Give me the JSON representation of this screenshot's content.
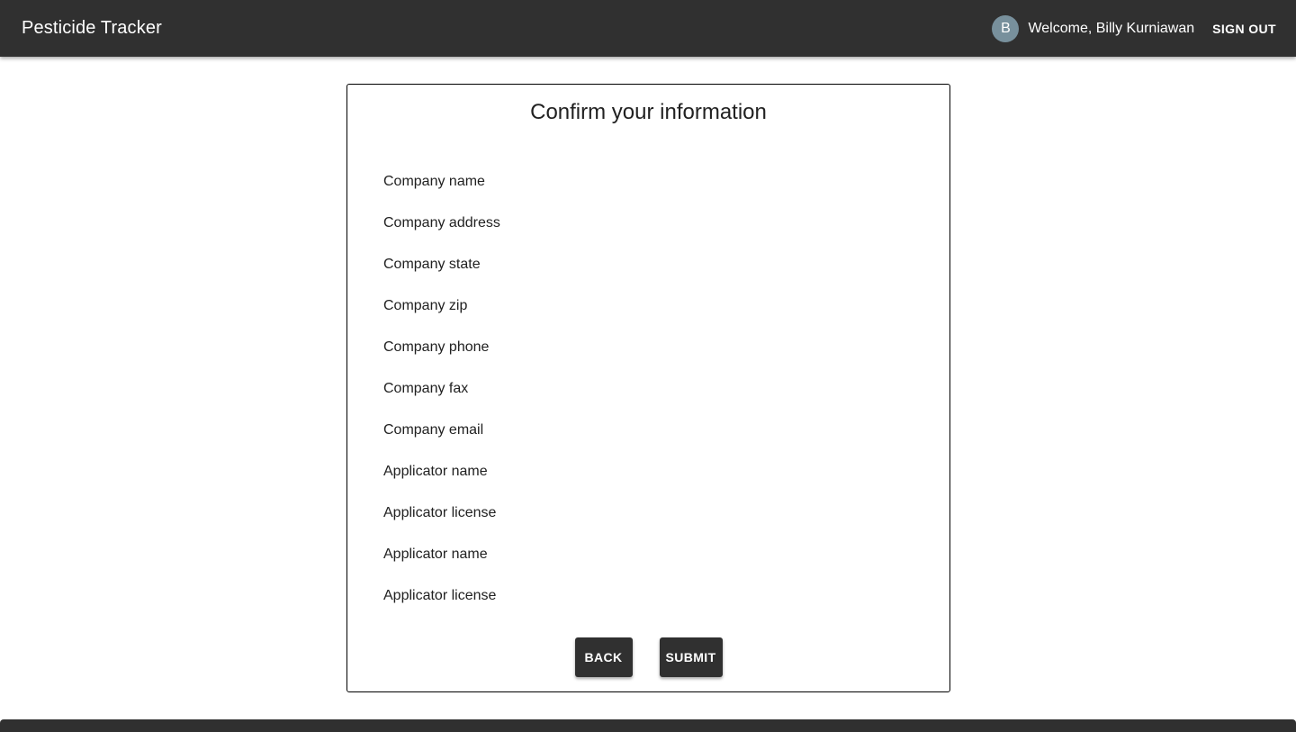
{
  "header": {
    "title": "Pesticide Tracker",
    "avatar_initial": "B",
    "welcome_text": "Welcome, Billy Kurniawan",
    "signout_label": "SIGN OUT"
  },
  "card": {
    "title": "Confirm your information",
    "fields": [
      "Company name",
      "Company address",
      "Company state",
      "Company zip",
      "Company phone",
      "Company fax",
      "Company email",
      "Applicator name",
      "Applicator license",
      "Applicator name",
      "Applicator license"
    ],
    "back_label": "BACK",
    "submit_label": "SUBMIT"
  },
  "colors": {
    "app_bar": "#303030",
    "avatar": "#78909c",
    "button": "#303030"
  }
}
